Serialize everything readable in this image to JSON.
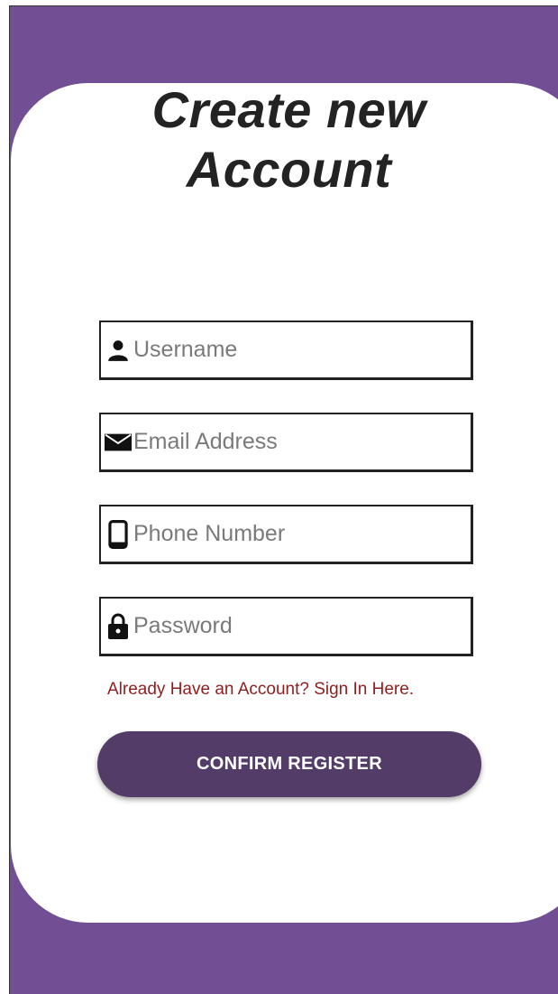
{
  "title": {
    "line1": "Create new",
    "line2": "Account"
  },
  "form": {
    "username": {
      "placeholder": "Username",
      "value": "",
      "icon": "person-icon"
    },
    "email": {
      "placeholder": "Email Address",
      "value": "",
      "icon": "envelope-icon"
    },
    "phone": {
      "placeholder": "Phone Number",
      "value": "",
      "icon": "phone-icon"
    },
    "password": {
      "placeholder": "Password",
      "value": "",
      "icon": "lock-icon"
    }
  },
  "signin_link": "Already Have an Account? Sign In Here.",
  "register_button": "CONFIRM REGISTER",
  "colors": {
    "background": "#724f94",
    "card": "#ffffff",
    "button": "#533c68",
    "link": "#8f1e1e",
    "title": "#232323"
  }
}
